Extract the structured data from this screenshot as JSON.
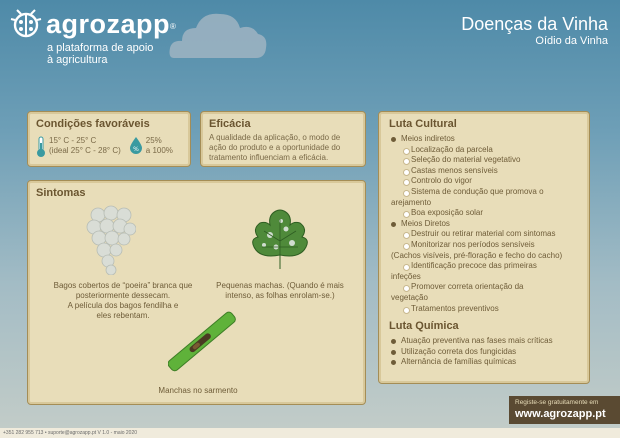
{
  "brand": {
    "name": "agrozapp",
    "registered": "®",
    "tagline_line1": "a plataforma de apoio",
    "tagline_line2": "à agricultura"
  },
  "title": {
    "main": "Doenças da Vinha",
    "sub": "Oídio da Vinha"
  },
  "condicoes": {
    "heading": "Condições favoráveis",
    "temp_line1": "15° C - 25° C",
    "temp_line2": "(ideal 25° C - 28° C)",
    "hum_line1": "25%",
    "hum_line2": "a 100%"
  },
  "eficacia": {
    "heading": "Eficácia",
    "text": "A qualidade da aplicação, o modo de ação do produto e a oportunidade do tratamento influenciam a eficácia."
  },
  "sintomas": {
    "heading": "Sintomas",
    "grapes_line1": "Bagos cobertos de “poeira” branca  que",
    "grapes_line2": "posteriormente dessecam.",
    "grapes_line3": "A película dos bagos fendilha e",
    "grapes_line4": "eles rebentam.",
    "leaf_line1": "Pequenas machas. (Quando é mais",
    "leaf_line2": "intenso, as folhas enrolam-se.)",
    "shoot_caption": "Manchas no sarmento"
  },
  "luta": {
    "cultural_heading": "Luta Cultural",
    "cultural_items": [
      {
        "level": "l1",
        "text": "Meios indiretos"
      },
      {
        "level": "l2",
        "text": "Localização da parcela"
      },
      {
        "level": "l2",
        "text": "Seleção do material vegetativo"
      },
      {
        "level": "l2",
        "text": "Castas menos sensíveis"
      },
      {
        "level": "l2",
        "text": "Controlo do vigor"
      },
      {
        "level": "l2",
        "text": "Sistema de condução que promova o"
      },
      {
        "level": "cont",
        "text": "arejamento"
      },
      {
        "level": "l2",
        "text": "Boa exposição solar"
      },
      {
        "level": "l1",
        "text": "Meios Diretos"
      },
      {
        "level": "l2",
        "text": "Destruir ou retirar material com sintomas"
      },
      {
        "level": "l2",
        "text": "Monitorizar nos períodos sensíveis"
      },
      {
        "level": "cont",
        "text": "(Cachos visíveis, pré-floração e fecho do cacho)"
      },
      {
        "level": "l2",
        "text": "Identificação precoce das primeiras"
      },
      {
        "level": "cont",
        "text": "infeções"
      },
      {
        "level": "l2",
        "text": "Promover correta orientação da"
      },
      {
        "level": "cont",
        "text": "vegetação"
      },
      {
        "level": "l2",
        "text": "Tratamentos preventivos"
      }
    ],
    "quimica_heading": "Luta Química",
    "quimica_items": [
      "Atuação preventiva nas fases mais críticas",
      "Utilização correta dos fungicidas",
      "Alternância de famílias químicas"
    ]
  },
  "cta": {
    "line1": "Registe-se gratuitamente em",
    "url": "www.agrozapp.pt"
  },
  "footer": {
    "text": "+351 282 955 713 • suporte@agrozapp.pt    V 1.0 - maio 2020"
  },
  "colors": {
    "panel_bg": "#e8ddb9",
    "panel_border": "#a48d56",
    "leaf_green": "#4f8a3a",
    "mildew_white": "#dfe6e0"
  }
}
